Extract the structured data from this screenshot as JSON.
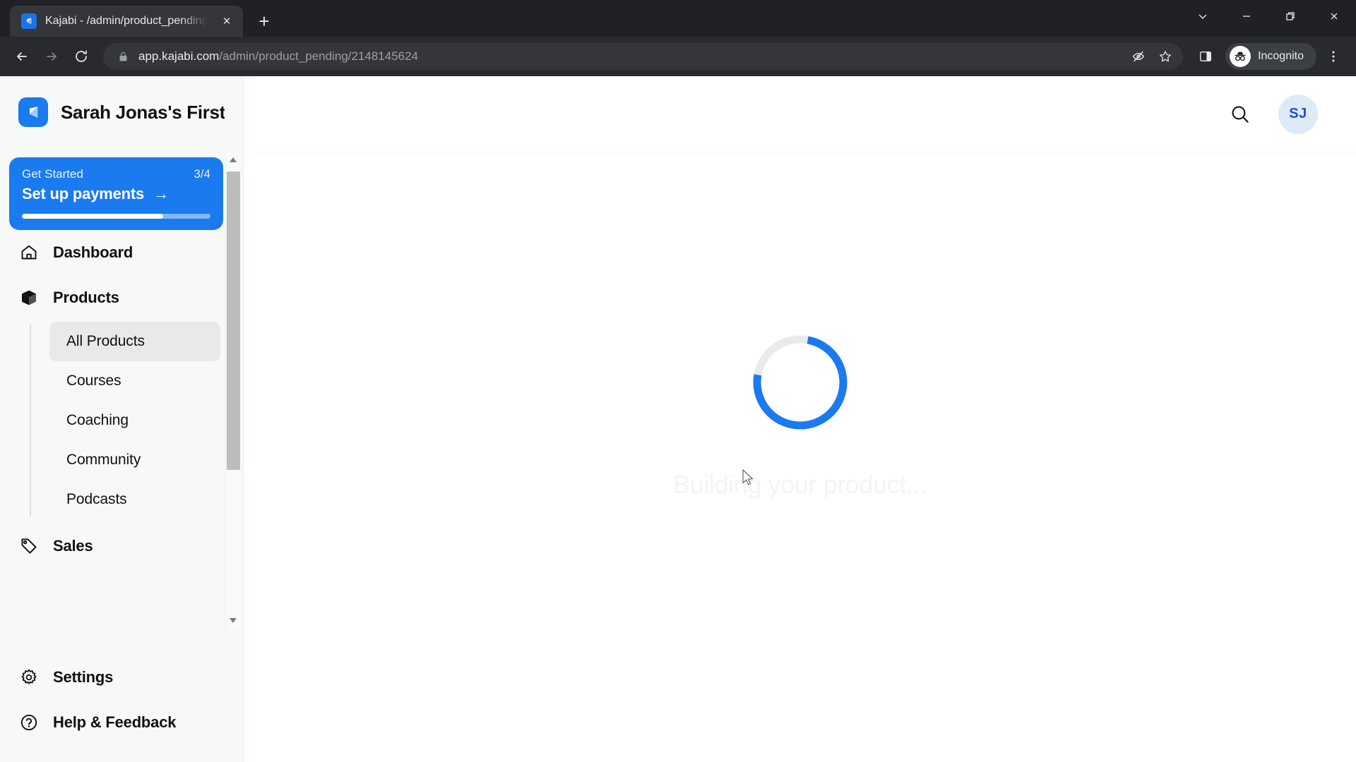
{
  "browser": {
    "tab": {
      "title": "Kajabi - /admin/product_pending",
      "favicon": "kajabi-logo-icon",
      "close_label": "×"
    },
    "new_tab_label": "+",
    "window_controls": [
      {
        "name": "search-tabs",
        "glyph": "chevron-down-icon"
      },
      {
        "name": "minimize",
        "glyph": "minimize-icon"
      },
      {
        "name": "maximize",
        "glyph": "maximize-icon"
      },
      {
        "name": "close",
        "glyph": "close-icon"
      }
    ],
    "toolbar": {
      "back_label": "←",
      "forward_label": "→",
      "reload_label": "reload-icon",
      "url_domain": "app.kajabi.com",
      "url_path": "/admin/product_pending/2148145624",
      "full_url": "app.kajabi.com/admin/product_pending/2148145624",
      "lock_icon": "lock-icon",
      "tracking_icon": "eye-off-icon",
      "bookmark_icon": "star-icon",
      "sidepanel_icon": "side-panel-icon",
      "incognito_label": "Incognito",
      "menu_icon": "three-dot-menu-icon"
    }
  },
  "app": {
    "brand": {
      "name": "Sarah Jonas's First",
      "logo": "kajabi-logo-icon",
      "logo_color": "#1a7af0"
    },
    "get_started": {
      "label": "Get Started",
      "count": "3/4",
      "title": "Set up payments",
      "arrow": "→",
      "progress_percent": 75,
      "background": "#1a7af0"
    },
    "nav": [
      {
        "label": "Dashboard",
        "icon": "home-icon"
      },
      {
        "label": "Products",
        "icon": "box-icon"
      }
    ],
    "products_subnav": [
      {
        "label": "All Products",
        "active": true
      },
      {
        "label": "Courses",
        "active": false
      },
      {
        "label": "Coaching",
        "active": false
      },
      {
        "label": "Community",
        "active": false
      },
      {
        "label": "Podcasts",
        "active": false
      }
    ],
    "nav_bottom": [
      {
        "label": "Sales",
        "icon": "tag-icon"
      },
      {
        "label": "Settings",
        "icon": "gear-icon"
      },
      {
        "label": "Help & Feedback",
        "icon": "help-circle-icon"
      }
    ],
    "topbar": {
      "search_icon": "search-icon",
      "avatar_initials": "SJ",
      "avatar_bg": "#dfeaf8",
      "avatar_color": "#1d4ed8"
    },
    "loading": {
      "text": "Building your product...",
      "spinner_color": "#1a7af0",
      "spinner_track_color": "#e9eaec",
      "spinner_progress_percent": 75
    }
  }
}
